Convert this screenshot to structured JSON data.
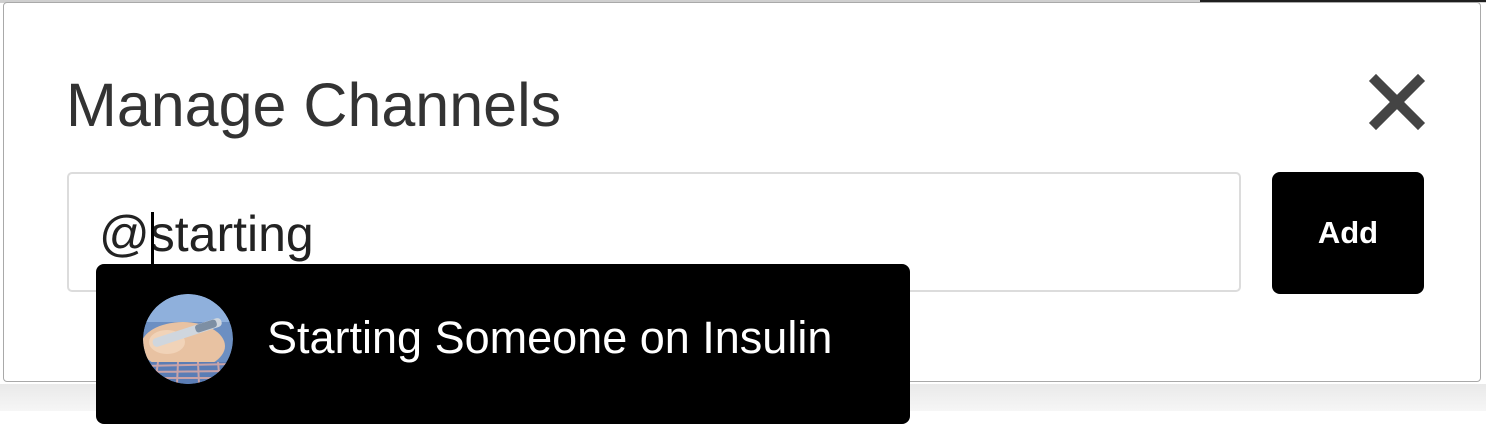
{
  "modal": {
    "title": "Manage Channels",
    "close_icon": "close-icon"
  },
  "channel_input": {
    "value": "@starting",
    "placeholder": ""
  },
  "add_button": {
    "label": "Add"
  },
  "suggestions": [
    {
      "label": "Starting Someone on Insulin",
      "avatar_icon": "channel-avatar-image"
    }
  ],
  "colors": {
    "button_background": "#000000",
    "button_text": "#ffffff",
    "title_text": "#333333",
    "dropdown_background": "#000000"
  }
}
